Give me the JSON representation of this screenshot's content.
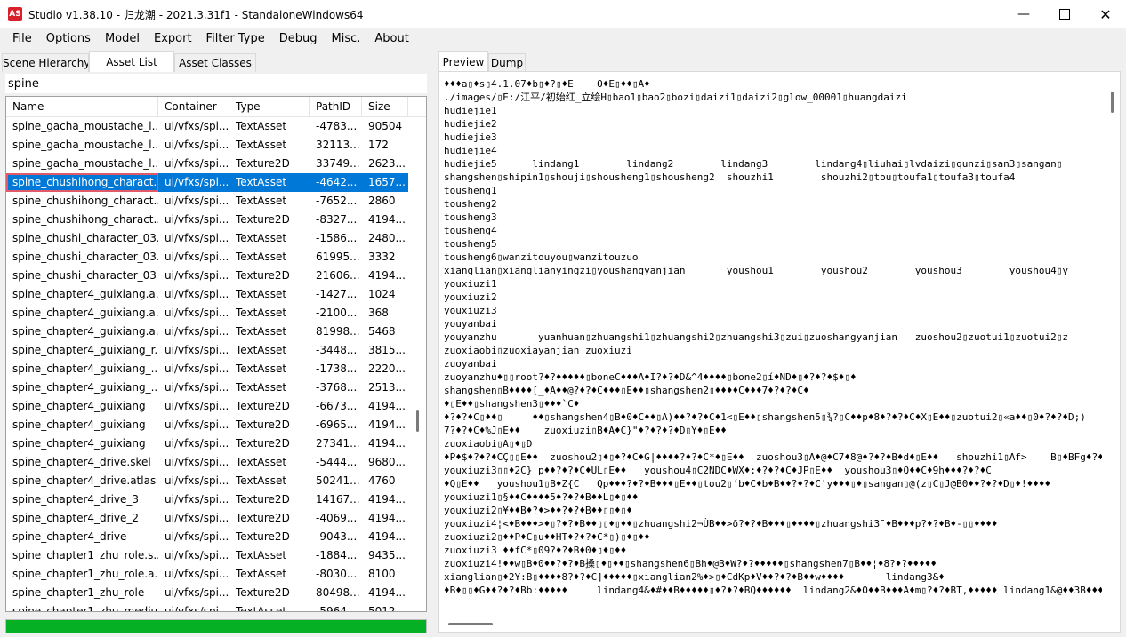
{
  "window": {
    "app_icon_text": "AS",
    "title": "Studio v1.38.10 - 归龙潮 - 2021.3.31f1 - StandaloneWindows64"
  },
  "menu": [
    "File",
    "Options",
    "Model",
    "Export",
    "Filter Type",
    "Debug",
    "Misc.",
    "About"
  ],
  "left_tabs": [
    "Scene Hierarchy",
    "Asset List",
    "Asset Classes"
  ],
  "left_active_tab": "Asset List",
  "search": {
    "value": "spine",
    "placeholder": ""
  },
  "asset_list": {
    "columns": [
      "Name",
      "Container",
      "Type",
      "PathID",
      "Size"
    ],
    "rows": [
      [
        "spine_gacha_moustache_l...",
        "ui/vfxs/spi...",
        "TextAsset",
        "-4783...",
        "90504"
      ],
      [
        "spine_gacha_moustache_l...",
        "ui/vfxs/spi...",
        "TextAsset",
        "32113...",
        "172"
      ],
      [
        "spine_gacha_moustache_l...",
        "ui/vfxs/spi...",
        "Texture2D",
        "33749...",
        "2623..."
      ],
      [
        "spine_chushihong_charact...",
        "ui/vfxs/spi...",
        "TextAsset",
        "-4642...",
        "1657..."
      ],
      [
        "spine_chushihong_charact...",
        "ui/vfxs/spi...",
        "TextAsset",
        "-7652...",
        "2860"
      ],
      [
        "spine_chushihong_charact...",
        "ui/vfxs/spi...",
        "Texture2D",
        "-8327...",
        "4194..."
      ],
      [
        "spine_chushi_character_03...",
        "ui/vfxs/spi...",
        "TextAsset",
        "-1586...",
        "2480..."
      ],
      [
        "spine_chushi_character_03...",
        "ui/vfxs/spi...",
        "TextAsset",
        "61995...",
        "3332"
      ],
      [
        "spine_chushi_character_03",
        "ui/vfxs/spi...",
        "Texture2D",
        "21606...",
        "4194..."
      ],
      [
        "spine_chapter4_guixiang.a...",
        "ui/vfxs/spi...",
        "TextAsset",
        "-1427...",
        "1024"
      ],
      [
        "spine_chapter4_guixiang.a...",
        "ui/vfxs/spi...",
        "TextAsset",
        "-2100...",
        "368"
      ],
      [
        "spine_chapter4_guixiang.a...",
        "ui/vfxs/spi...",
        "TextAsset",
        "81998...",
        "5468"
      ],
      [
        "spine_chapter4_guixiang_r...",
        "ui/vfxs/spi...",
        "TextAsset",
        "-3448...",
        "3815..."
      ],
      [
        "spine_chapter4_guixiang_...",
        "ui/vfxs/spi...",
        "TextAsset",
        "-1738...",
        "2220..."
      ],
      [
        "spine_chapter4_guixiang_...",
        "ui/vfxs/spi...",
        "TextAsset",
        "-3768...",
        "2513..."
      ],
      [
        "spine_chapter4_guixiang",
        "ui/vfxs/spi...",
        "Texture2D",
        "-6673...",
        "4194..."
      ],
      [
        "spine_chapter4_guixiang",
        "ui/vfxs/spi...",
        "Texture2D",
        "-6965...",
        "4194..."
      ],
      [
        "spine_chapter4_guixiang",
        "ui/vfxs/spi...",
        "Texture2D",
        "27341...",
        "4194..."
      ],
      [
        "spine_chapter4_drive.skel",
        "ui/vfxs/spi...",
        "TextAsset",
        "-5444...",
        "9680..."
      ],
      [
        "spine_chapter4_drive.atlas",
        "ui/vfxs/spi...",
        "TextAsset",
        "50241...",
        "4760"
      ],
      [
        "spine_chapter4_drive_3",
        "ui/vfxs/spi...",
        "Texture2D",
        "14167...",
        "4194..."
      ],
      [
        "spine_chapter4_drive_2",
        "ui/vfxs/spi...",
        "Texture2D",
        "-4069...",
        "4194..."
      ],
      [
        "spine_chapter4_drive",
        "ui/vfxs/spi...",
        "Texture2D",
        "-9043...",
        "4194..."
      ],
      [
        "spine_chapter1_zhu_role.s...",
        "ui/vfxs/spi...",
        "TextAsset",
        "-1884...",
        "9435..."
      ],
      [
        "spine_chapter1_zhu_role.a...",
        "ui/vfxs/spi...",
        "TextAsset",
        "-8030...",
        "8100"
      ],
      [
        "spine_chapter1_zhu_role",
        "ui/vfxs/spi...",
        "Texture2D",
        "80498...",
        "4194..."
      ],
      [
        "spine_chapter1_zhu_mediu...",
        "ui/vfxs/spi...",
        "TextAsset",
        "-5964...",
        "5012..."
      ]
    ],
    "selected_row_index": 3,
    "scroll_position_fraction": 0.62
  },
  "progress": {
    "value_fraction": 1.0,
    "color": "#06b025"
  },
  "right_tabs": [
    "Preview",
    "Dump"
  ],
  "right_active_tab": "Preview",
  "preview_lines": [
    "♦♦♦a▯♦s▯4.1.07♦b▯♦?▯♦E    O♦E▯♦♦▯A♦",
    "./images/▯E:/江平/初始红_立绘H▯bao1▯bao2▯bozi▯daizi1▯daizi2▯glow_00001▯huangdaizi",
    "hudiejie1",
    "hudiejie2",
    "hudiejie3",
    "hudiejie4",
    "hudiejie5      lindang1        lindang2        lindang3        lindang4▯liuhai▯lvdaizi▯qunzi▯san3▯sangan▯",
    "shangshen▯shipin1▯shouji▯shousheng1▯shousheng2  shouzhi1        shouzhi2▯tou▯toufa1▯toufa3▯toufa4",
    "tousheng1",
    "tousheng2",
    "tousheng3",
    "tousheng4",
    "tousheng5",
    "tousheng6▯wanzitouyou▯wanzitouzuo",
    "xianglian▯xianglianyingzi▯youshangyanjian       youshou1        youshou2        youshou3        youshou4▯y",
    "youxiuzi1",
    "youxiuzi2",
    "youxiuzi3",
    "youyanbai",
    "youyanzhu       yuanhuan▯zhuangshi1▯zhuangshi2▯zhuangshi3▯zui▯zuoshangyanjian   zuoshou2▯zuotui1▯zuotui2▯z",
    "zuoxiaobi▯zuoxiayanjian zuoxiuzi",
    "zuoyanbai",
    "zuoyanzhu♦▯▯root?♦?♦♦♦♦♦▯boneC♦♦♦A♦I?♦?♦D&^4♦♦♦♦▯bone2▯í♦ND♦▯♦?♦?♦$♦▯♦",
    "shangshen▯B♦♦♦♦[_♦A♦♦@?♦?♦C♦♦♦▯E♦♦▯shangshen2▯♦♦♦♦C♦♦♦7♦?♦?♦C♦",
    "♦▯E♦♦▯shangshen3▯♦♦♦`C♦",
    "♦?♦?♦C▯♦♦▯     ♦♦▯shangshen4▯B♦0♦C♦♦▯A)♦♦?♦?♦C♦1<▯E♦♦▯shangshen5▯¾?▯C♦♦p♦8♦?♦?♦C♦X▯E♦♦▯zuotui2▯«a♦♦▯0♦?♦?♦D;)",
    "7?♦?♦C♦%J▯E♦♦    zuoxiuzi▯B♦A♦C}\"♦?♦?♦?♦D▯Y♦▯E♦♦",
    "zuoxiaobi▯A▯♦▯D",
    "♦P♦$♦?♦?♦CÇ▯▯E♦♦  zuoshou2▯♦▯♦?♦C♦G|♦♦♦♦?♦?♦C*♦▯E♦♦  zuoshou3▯A♦@♦C7♦8@♦?♦?♦B♦d♦▯E♦♦   shouzhi1▯Af>    B▯♦BFg♦?♦?",
    "youxiuzi3▯▯♦2C} p♦♦?♦?♦C♦UL▯E♦♦   youshou4▯C2NDC♦WX♦:♦?♦?♦C♦JP▯E♦♦  youshou3▯♦Q♦♦C♦9h♦♦♦?♦?♦C",
    "♦Q▯E♦♦   youshou1▯B♦Z{C   Qp♦♦♦?♦?♦B♦♦♦▯E♦♦▯tou2▯´b♦C♦b♦B♦♦?♦?♦C'y♦♦♦▯♦▯sangan▯@(z▯C▯J@B0♦♦?♦?♦D▯♦!♦♦♦♦",
    "youxiuzi1▯§♦♦C♦♦♦♦5♦?♦?♦B♦♦L▯♦▯♦♦",
    "youxiuzi2▯¥♦♦B♦?♦>♦♦?♦?♦B♦♦▯▯♦▯♦",
    "youxiuzi4¦<♦B♦♦♦>♦▯?♦?♦B♦♦▯▯♦▯♦♦▯zhuangshi2¬ÙB♦♦>ð?♦?♦B♦♦♦▯♦♦♦♦▯zhuangshi3¯♦B♦♦♦p?♦?♦B♦-▯▯♦♦♦♦",
    "zuoxiuzi2▯♦♦P♦C▯u♦♦HT♦?♦?♦C*▯)▯♦▯♦♦",
    "zuoxiuzi3 ♦♦fC*▯09?♦?♦B♦0♦▯♦▯♦♦",
    "zuoxiuzi4!♦♦w▯B♦0♦♦?♦?♦B搡▯♦▯♦♦▯shangshen6▯Bh♦@B♦W?♦?♦♦♦♦♦▯shangshen7▯B♦♦¦♦8?♦?♦♦♦♦♦",
    "xianglian▯♦2Y:B▯♦♦♦♦8?♦?♦C]♦♦♦♦♦▯xianglian2%♦>▯♦CdKp♦V♦♦?♦?♦B♦♦w♦♦♦♦       lindang3&♦",
    "♦B♦▯▯♦G♦♦?♦?♦Bb:♦♦♦♦♦     lindang4&♦#♦♦B♦♦♦♦♦▯♦?♦?♦BQ♦♦♦♦♦♦  lindang2&♦O♦♦B♦♦♦A♦m▯?♦?♦BT,♦♦♦♦♦ lindang1&@♦♦3B♦♦♦B"
  ]
}
